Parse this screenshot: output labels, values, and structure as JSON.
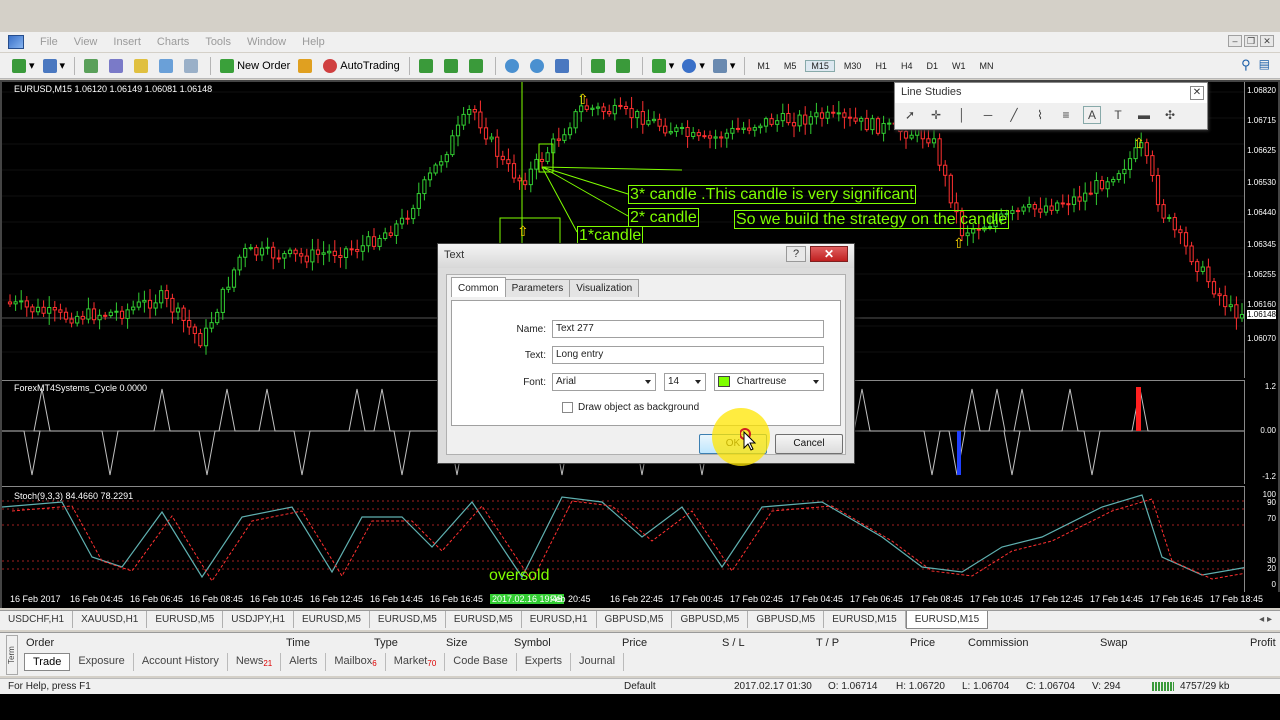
{
  "menu": {
    "items": [
      "File",
      "View",
      "Insert",
      "Charts",
      "Tools",
      "Window",
      "Help"
    ]
  },
  "toolbar": {
    "new_order": "New Order",
    "auto_trading": "AutoTrading",
    "timeframes": [
      "M1",
      "M5",
      "M15",
      "M30",
      "H1",
      "H4",
      "D1",
      "W1",
      "MN"
    ],
    "active_timeframe": "M15"
  },
  "chart": {
    "main_label": "EURUSD,M15  1.06120 1.06149 1.06081 1.06148",
    "main_yticks": [
      "1.06820",
      "1.06715",
      "1.06625",
      "1.06530",
      "1.06440",
      "1.06345",
      "1.06255",
      "1.06160",
      "1.06148",
      "1.06070"
    ],
    "current_price": "1.06148",
    "cycle_label": "ForexMT4Systems_Cycle 0.0000",
    "cycle_yticks": [
      "1.2",
      "0.00",
      "-1.2"
    ],
    "stoch_label": "Stoch(9,3,3) 84.4660 78.2291",
    "stoch_yticks": [
      "100",
      "90",
      "70",
      "30",
      "20",
      "0"
    ],
    "xticks": [
      "16 Feb 2017",
      "16 Feb 04:45",
      "16 Feb 06:45",
      "16 Feb 08:45",
      "16 Feb 10:45",
      "16 Feb 12:45",
      "16 Feb 14:45",
      "16 Feb 16:45",
      "2017.02.16 19:45",
      "Feb 20:45",
      "16 Feb 22:45",
      "17 Feb 00:45",
      "17 Feb 02:45",
      "17 Feb 04:45",
      "17 Feb 06:45",
      "17 Feb 08:45",
      "17 Feb 10:45",
      "17 Feb 12:45",
      "17 Feb 14:45",
      "17 Feb 16:45",
      "17 Feb 18:45"
    ],
    "highlighted_xtick": "2017.02.16 19:45",
    "annotations": {
      "candle3": "3* candle .This candle is very significant",
      "candle2": "2* candle",
      "strategy": "So we build the strategy on the candle",
      "candle1": "1*candle",
      "oversold": "oversold"
    }
  },
  "line_studies": {
    "title": "Line Studies",
    "tools": [
      "cursor-icon",
      "crosshair-icon",
      "vertical-line-icon",
      "horizontal-line-icon",
      "trendline-icon",
      "fibonacci-icon",
      "channel-icon",
      "text-icon",
      "text-label-icon",
      "arrow-label-icon",
      "arrows-icon"
    ]
  },
  "dialog": {
    "title": "Text",
    "help": "?",
    "close": "✕",
    "tabs": [
      "Common",
      "Parameters",
      "Visualization"
    ],
    "active_tab": "Common",
    "name_label": "Name:",
    "name_value": "Text 277",
    "text_label": "Text:",
    "text_value": "Long entry",
    "font_label": "Font:",
    "font_value": "Arial",
    "size_value": "14",
    "color_value": "Chartreuse",
    "color_hex": "#7fff00",
    "background_label": "Draw object as background",
    "background_checked": false,
    "ok": "OK",
    "cancel": "Cancel"
  },
  "symbol_tabs": [
    "USDCHF,H1",
    "XAUUSD,H1",
    "EURUSD,M5",
    "USDJPY,H1",
    "EURUSD,M5",
    "EURUSD,M5",
    "EURUSD,M5",
    "EURUSD,H1",
    "GBPUSD,M5",
    "GBPUSD,M5",
    "GBPUSD,M5",
    "EURUSD,M15",
    "EURUSD,M15"
  ],
  "active_symbol_tab": 12,
  "terminal": {
    "side_label": "Term",
    "headers": [
      "Order",
      "Time",
      "Type",
      "Size",
      "Symbol",
      "Price",
      "S / L",
      "T / P",
      "Price",
      "Commission",
      "Swap",
      "Profit"
    ],
    "tabs": [
      {
        "label": "Trade",
        "badge": ""
      },
      {
        "label": "Exposure",
        "badge": ""
      },
      {
        "label": "Account History",
        "badge": ""
      },
      {
        "label": "News",
        "badge": "21"
      },
      {
        "label": "Alerts",
        "badge": ""
      },
      {
        "label": "Mailbox",
        "badge": "6"
      },
      {
        "label": "Market",
        "badge": "70"
      },
      {
        "label": "Code Base",
        "badge": ""
      },
      {
        "label": "Experts",
        "badge": ""
      },
      {
        "label": "Journal",
        "badge": ""
      }
    ]
  },
  "status": {
    "help": "For Help, press F1",
    "profile": "Default",
    "datetime": "2017.02.17 01:30",
    "open": "O: 1.06714",
    "high": "H: 1.06720",
    "low": "L: 1.06704",
    "close": "C: 1.06704",
    "volume": "V: 294",
    "traffic": "4757/29 kb"
  }
}
